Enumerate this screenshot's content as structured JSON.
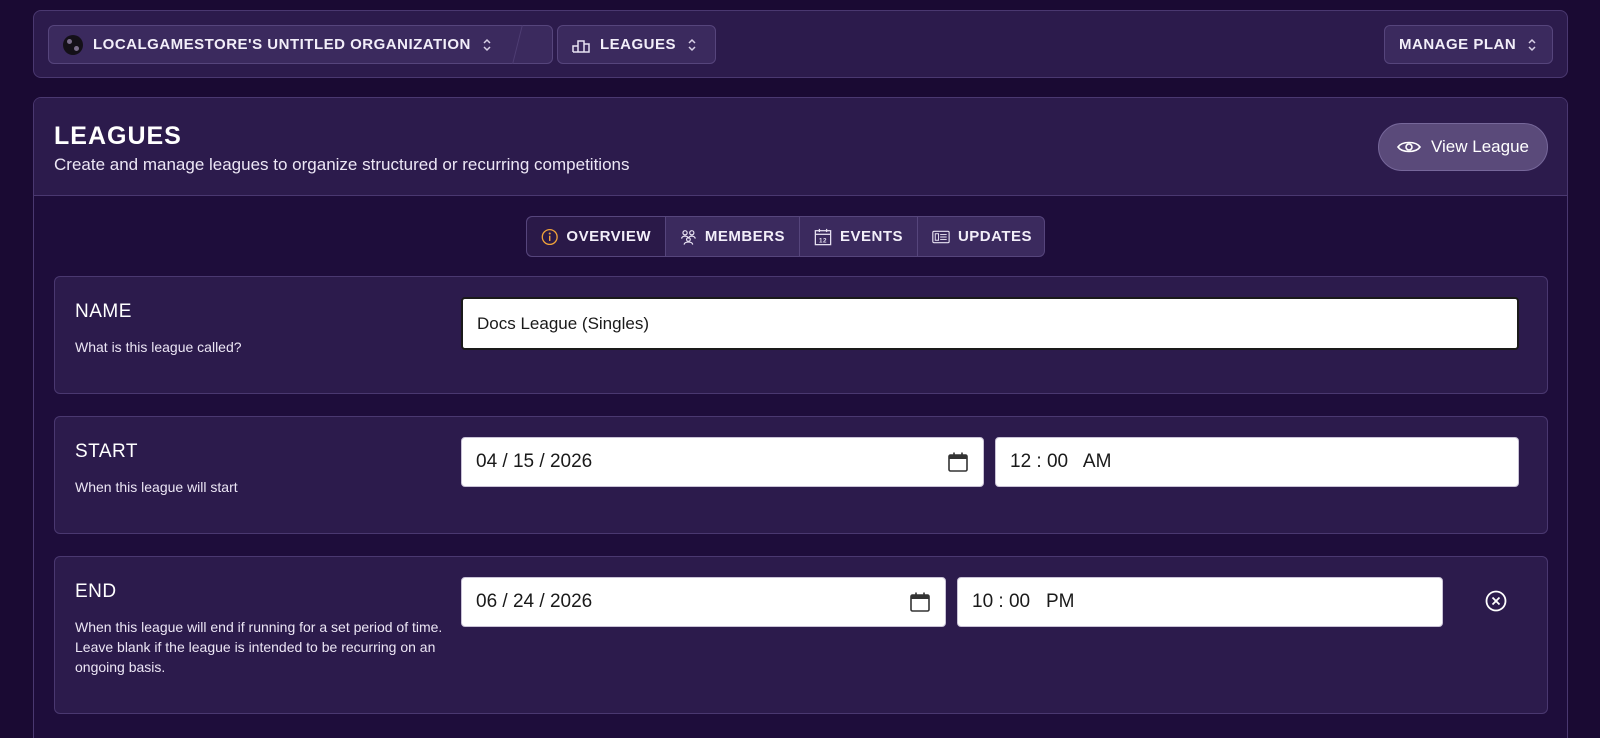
{
  "topbar": {
    "org_label": "LOCALGAMESTORE'S UNTITLED ORGANIZATION",
    "section_label": "LEAGUES",
    "plan_label": "MANAGE PLAN"
  },
  "header": {
    "title": "LEAGUES",
    "subtitle": "Create and manage leagues to organize structured or recurring competitions",
    "view_button": "View League"
  },
  "tabs": [
    {
      "label": "OVERVIEW",
      "icon": "info-icon",
      "active": true
    },
    {
      "label": "MEMBERS",
      "icon": "members-icon"
    },
    {
      "label": "EVENTS",
      "icon": "calendar-icon"
    },
    {
      "label": "UPDATES",
      "icon": "updates-icon"
    }
  ],
  "form": {
    "name": {
      "label": "NAME",
      "description": "What is this league called?",
      "value": "Docs League (Singles)"
    },
    "start": {
      "label": "START",
      "description": "When this league will start",
      "date": "04 / 15 / 2026",
      "time": "12 : 00   AM"
    },
    "end": {
      "label": "END",
      "description": "When this league will end if running for a set period of time. Leave blank if the league is intended to be recurring on an ongoing basis.",
      "date": "06 / 24 / 2026",
      "time": "10 : 00   PM"
    }
  },
  "colors": {
    "background": "#1a0a33",
    "panel": "#2c1b4c",
    "accent_info": "#f0a23a"
  }
}
